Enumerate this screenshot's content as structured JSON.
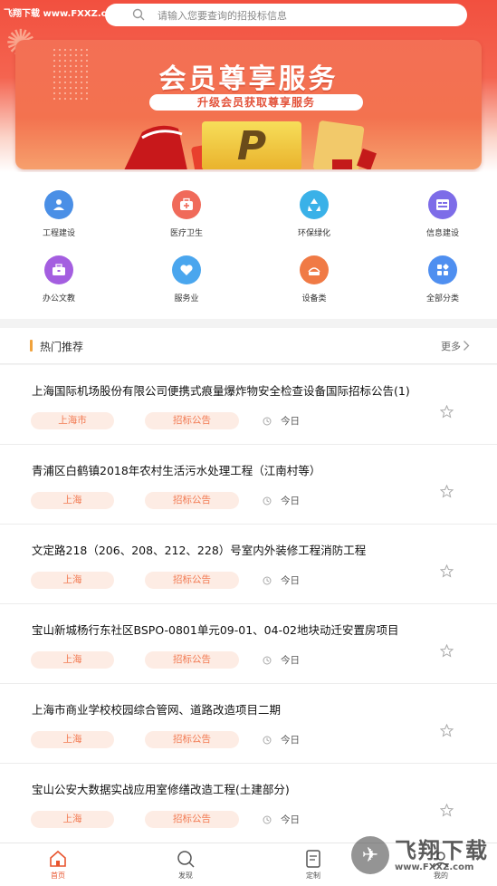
{
  "watermark": "飞翔下载 www.FXXZ.com",
  "search": {
    "placeholder": "请输入您要查询的招投标信息",
    "icon": "search-icon"
  },
  "banner": {
    "title": "会员尊享服务",
    "subtitle": "升级会员获取尊享服务",
    "badge_letter": "P"
  },
  "categories": [
    {
      "label": "工程建设",
      "icon": "person-upload-icon",
      "color": "#4a8fe6"
    },
    {
      "label": "医疗卫生",
      "icon": "medical-kit-icon",
      "color": "#f06a5a"
    },
    {
      "label": "环保绿化",
      "icon": "recycle-icon",
      "color": "#3ab1e8"
    },
    {
      "label": "信息建设",
      "icon": "info-panel-icon",
      "color": "#7d6ce8"
    },
    {
      "label": "办公文教",
      "icon": "briefcase-icon",
      "color": "#a45ee0"
    },
    {
      "label": "服务业",
      "icon": "heart-icon",
      "color": "#4aa6ee"
    },
    {
      "label": "设备类",
      "icon": "equipment-icon",
      "color": "#f07a45"
    },
    {
      "label": "全部分类",
      "icon": "all-categories-icon",
      "color": "#4f8ff0"
    }
  ],
  "hot": {
    "title": "热门推荐",
    "more": "更多"
  },
  "items": [
    {
      "title": "上海国际机场股份有限公司便携式痕量爆炸物安全检查设备国际招标公告(1)",
      "city": "上海市",
      "type": "招标公告",
      "time": "今日"
    },
    {
      "title": "青浦区白鹤镇2018年农村生活污水处理工程（江南村等）",
      "city": "上海",
      "type": "招标公告",
      "time": "今日"
    },
    {
      "title": "文定路218（206、208、212、228）号室内外装修工程消防工程",
      "city": "上海",
      "type": "招标公告",
      "time": "今日"
    },
    {
      "title": "宝山新城杨行东社区BSPO-0801单元09-01、04-02地块动迁安置房项目",
      "city": "上海",
      "type": "招标公告",
      "time": "今日"
    },
    {
      "title": "上海市商业学校校园综合管网、道路改造项目二期",
      "city": "上海",
      "type": "招标公告",
      "time": "今日"
    },
    {
      "title": "宝山公安大数据实战应用室修缮改造工程(土建部分)",
      "city": "上海",
      "type": "招标公告",
      "time": "今日"
    }
  ],
  "tabs": [
    {
      "label": "首页",
      "icon": "home-icon",
      "active": true
    },
    {
      "label": "发现",
      "icon": "discover-icon",
      "active": false
    },
    {
      "label": "定制",
      "icon": "customize-icon",
      "active": false
    },
    {
      "label": "我的",
      "icon": "profile-icon",
      "active": false
    }
  ],
  "logo_watermark": {
    "zh": "飞翔下载",
    "en": "www.FXXZ.com"
  },
  "colors": {
    "primary": "#f2503f",
    "tag_bg": "#fdece4",
    "tag_text": "#f27a52",
    "accent_bar": "#f0a23c"
  }
}
